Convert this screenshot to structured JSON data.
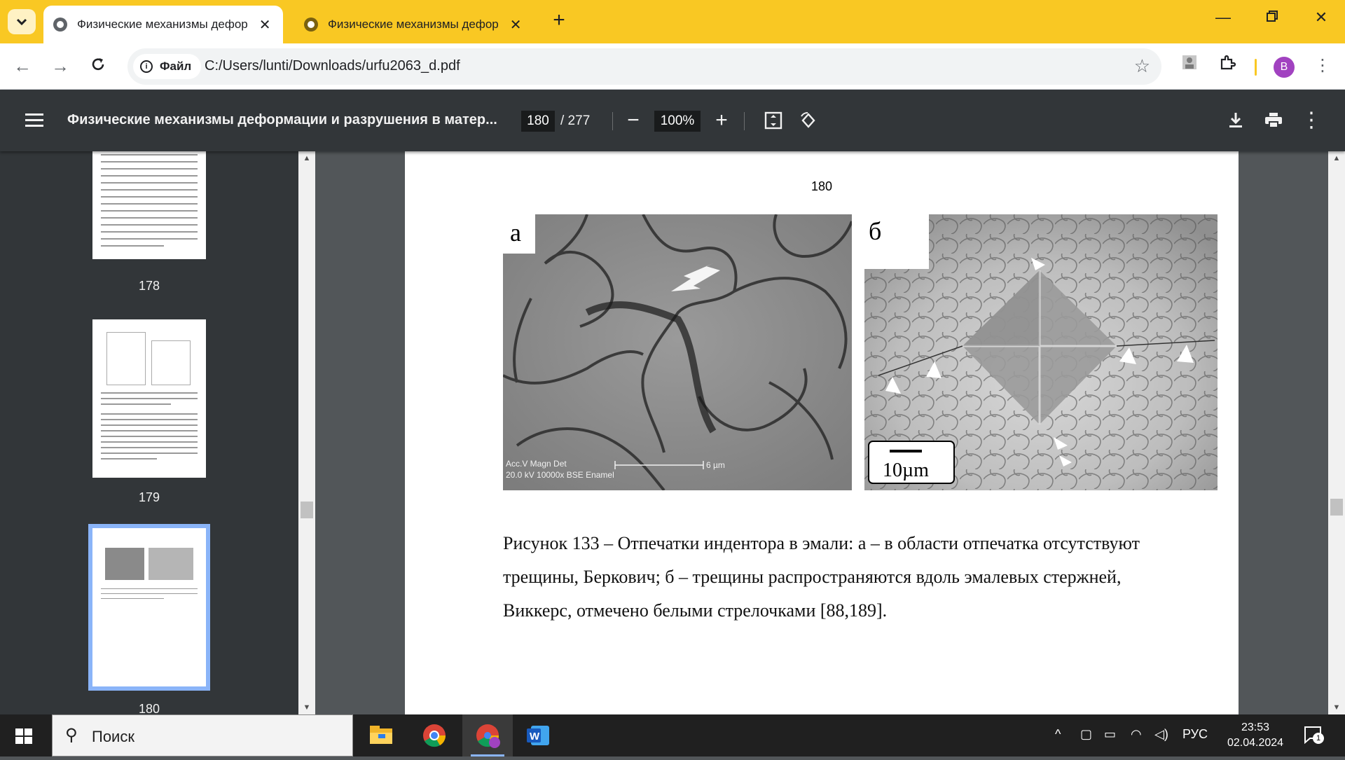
{
  "tabs": [
    {
      "title": "Физические механизмы дефор",
      "active": true
    },
    {
      "title": "Физические механизмы дефор",
      "active": false
    }
  ],
  "toolbar": {
    "site_chip": "Файл",
    "url": "C:/Users/lunti/Downloads/urfu2063_d.pdf",
    "avatar_letter": "B"
  },
  "pdf": {
    "title": "Физические механизмы деформации и разрушения в матер...",
    "current_page": "180",
    "total_pages": "/ 277",
    "zoom": "100%"
  },
  "thumbnails": [
    {
      "label": "178"
    },
    {
      "label": "179"
    },
    {
      "label": "180"
    }
  ],
  "page": {
    "number": "180",
    "figure": {
      "label_a": "а",
      "label_b": "б",
      "sem_line1": "Acc.V   Magn    Det  ",
      "sem_scale": "6 µm",
      "sem_line2": "20.0 kV 10000x  BSE Enamel",
      "scale_b": "10µm"
    },
    "caption_lines": [
      "Рисунок 133 – Отпечатки индентора в эмали: а – в области отпечатка отсутствуют",
      "трещины, Беркович; б – трещины распространяются вдоль эмалевых стержней,",
      "Виккерс, отмечено белыми стрелочками [88,189]."
    ]
  },
  "taskbar": {
    "search_placeholder": "Поиск",
    "language": "РУС",
    "time": "23:53",
    "date": "02.04.2024",
    "notification_count": "1"
  },
  "colors": {
    "tabstrip": "#f9c823",
    "pdf_toolbar": "#323639",
    "viewer_bg": "#525659",
    "thumb_selected": "#8ab4f8"
  }
}
